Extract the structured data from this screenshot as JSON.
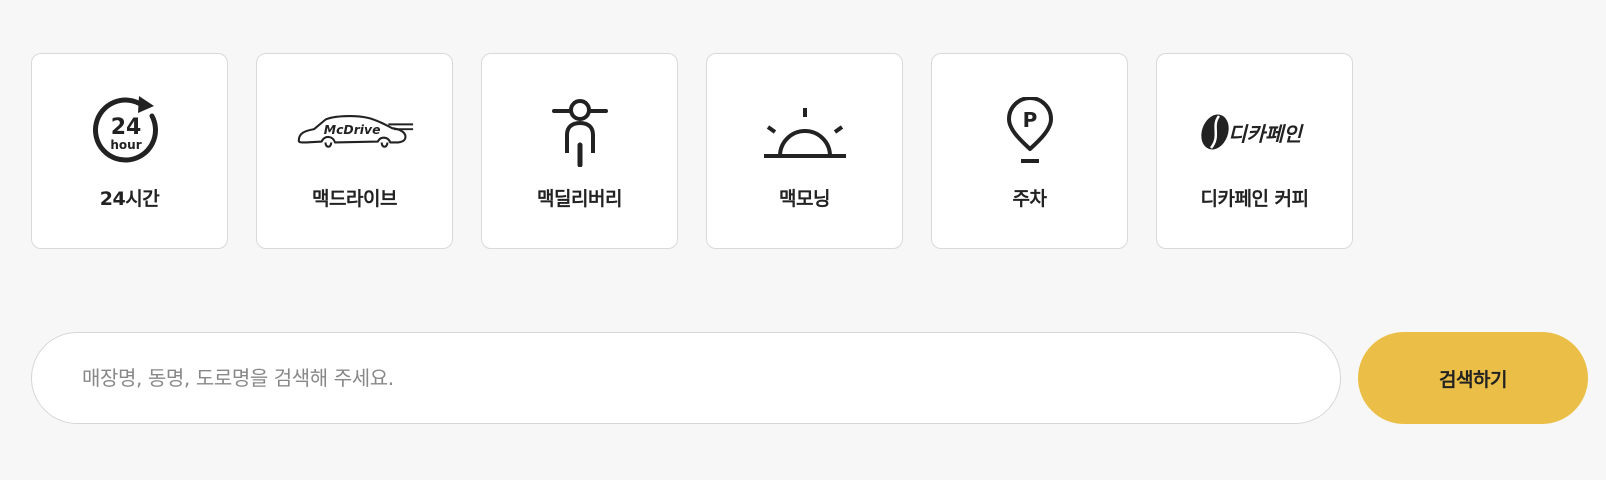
{
  "filters": [
    {
      "label": "24시간",
      "icon": "24-hour-icon",
      "icon_text": "24",
      "icon_subtext": "hour"
    },
    {
      "label": "맥드라이브",
      "icon": "mcdrive-car-icon",
      "icon_text": "McDrive"
    },
    {
      "label": "맥딜리버리",
      "icon": "delivery-scooter-icon"
    },
    {
      "label": "맥모닝",
      "icon": "sunrise-icon"
    },
    {
      "label": "주차",
      "icon": "parking-pin-icon",
      "icon_text": "P"
    },
    {
      "label": "디카페인 커피",
      "icon": "decaf-coffee-bean-icon",
      "icon_text": "디카페인"
    }
  ],
  "search": {
    "placeholder": "매장명, 동명, 도로명을 검색해 주세요.",
    "value": "",
    "button_label": "검색하기"
  },
  "colors": {
    "accent": "#ebbf47",
    "background": "#f7f7f7",
    "card_border": "#d9d9d9",
    "icon": "#222222"
  }
}
